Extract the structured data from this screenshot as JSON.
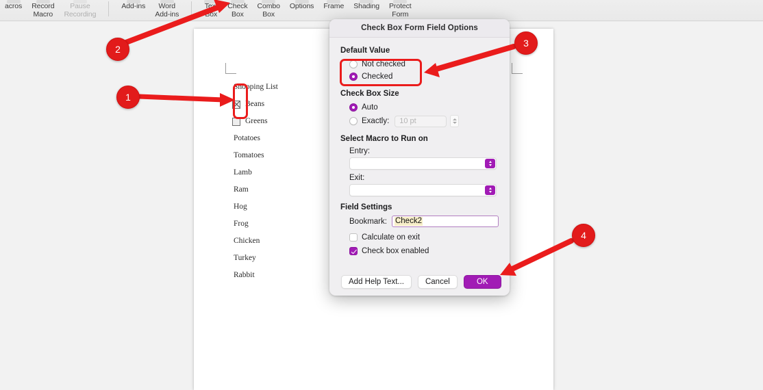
{
  "toolbar": {
    "groups": [
      {
        "items": [
          {
            "label": "acros",
            "icon": "macros-icon",
            "dim": false
          },
          {
            "label": "Record\nMacro",
            "icon": "record-macro-icon",
            "dim": false
          },
          {
            "label": "Pause\nRecording",
            "icon": "pause-recording-icon",
            "dim": true
          }
        ]
      },
      {
        "items": [
          {
            "label": "Add-ins",
            "icon": "add-ins-icon",
            "dim": false
          },
          {
            "label": "Word\nAdd-ins",
            "icon": "word-add-ins-icon",
            "dim": false
          }
        ]
      },
      {
        "items": [
          {
            "label": "Text\nBox",
            "icon": "text-box-icon",
            "dim": false
          },
          {
            "label": "Check\nBox",
            "icon": "check-box-icon",
            "dim": false
          },
          {
            "label": "Combo\nBox",
            "icon": "combo-box-icon",
            "dim": false
          },
          {
            "label": "Options",
            "icon": "options-icon",
            "dim": false
          },
          {
            "label": "Frame",
            "icon": "frame-icon",
            "dim": false
          },
          {
            "label": "Shading",
            "icon": "shading-icon",
            "dim": false
          },
          {
            "label": "Protect\nForm",
            "icon": "protect-form-icon",
            "dim": false
          }
        ]
      }
    ]
  },
  "document": {
    "title": "Shopping List",
    "form_items": [
      {
        "label": "Beans",
        "checked": true
      },
      {
        "label": "Greens",
        "checked": false
      }
    ],
    "plain_items": [
      "Potatoes",
      "Tomatoes",
      "Lamb",
      "Ram",
      "Hog",
      "Frog",
      "Chicken",
      "Turkey",
      "Rabbit"
    ]
  },
  "dialog": {
    "title": "Check Box Form Field Options",
    "default_value": {
      "heading": "Default Value",
      "options": [
        {
          "label": "Not checked",
          "selected": false
        },
        {
          "label": "Checked",
          "selected": true
        }
      ]
    },
    "check_box_size": {
      "heading": "Check Box Size",
      "options": [
        {
          "label": "Auto",
          "selected": true
        },
        {
          "label": "Exactly:",
          "selected": false
        }
      ],
      "exact_value": "10 pt"
    },
    "macro": {
      "heading": "Select Macro to Run on",
      "entry_label": "Entry:",
      "entry_value": "",
      "exit_label": "Exit:",
      "exit_value": ""
    },
    "field_settings": {
      "heading": "Field Settings",
      "bookmark_label": "Bookmark:",
      "bookmark_value": "Check2",
      "checkboxes": [
        {
          "label": "Calculate on exit",
          "checked": false
        },
        {
          "label": "Check box enabled",
          "checked": true
        }
      ]
    },
    "buttons": {
      "help": "Add Help Text...",
      "cancel": "Cancel",
      "ok": "OK"
    }
  },
  "annotations": {
    "badges": [
      {
        "number": "1"
      },
      {
        "number": "2"
      },
      {
        "number": "3"
      },
      {
        "number": "4"
      }
    ]
  },
  "colors": {
    "accent_purple": "#a11bb5",
    "annotation_red": "#e21b1b",
    "highlight_yellow": "#f7eec9",
    "focus_ring": "#b17ec0"
  }
}
